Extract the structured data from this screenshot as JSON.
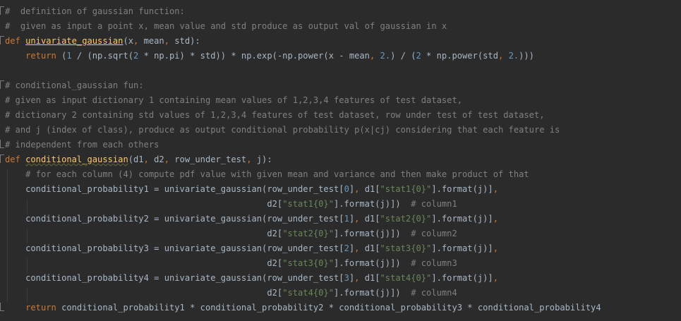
{
  "editor": {
    "background": "#2b2b2b",
    "colors": {
      "comment": "#808080",
      "keyword": "#cc7832",
      "function": "#ffc66d",
      "number": "#6897bb",
      "string": "#6a8759",
      "text": "#a9b7c6"
    },
    "lines": [
      {
        "tokens": [
          {
            "c": "cm",
            "t": "#  definition of gaussian function:"
          }
        ]
      },
      {
        "tokens": [
          {
            "c": "cm",
            "t": "#  given as input a point x, mean value and std produce as output val of gaussian in x"
          }
        ]
      },
      {
        "tokens": [
          {
            "c": "kw",
            "t": "def "
          },
          {
            "c": "fn",
            "t": "univariate_gaussian"
          },
          {
            "c": "var",
            "t": "(x"
          },
          {
            "c": "punct",
            "t": ", "
          },
          {
            "c": "var",
            "t": "mean"
          },
          {
            "c": "punct",
            "t": ", "
          },
          {
            "c": "var",
            "t": "std):"
          }
        ]
      },
      {
        "tokens": [
          {
            "c": "var",
            "t": "    "
          },
          {
            "c": "kw",
            "t": "return "
          },
          {
            "c": "var",
            "t": "("
          },
          {
            "c": "num",
            "t": "1"
          },
          {
            "c": "var",
            "t": " / (np.sqrt("
          },
          {
            "c": "num",
            "t": "2"
          },
          {
            "c": "var",
            "t": " * np.pi) * std)) * np.exp(-np.power(x - mean"
          },
          {
            "c": "punct",
            "t": ", "
          },
          {
            "c": "num",
            "t": "2."
          },
          {
            "c": "var",
            "t": ") / ("
          },
          {
            "c": "num",
            "t": "2"
          },
          {
            "c": "var",
            "t": " * np.power(std"
          },
          {
            "c": "punct",
            "t": ", "
          },
          {
            "c": "num",
            "t": "2."
          },
          {
            "c": "var",
            "t": ")))"
          }
        ]
      },
      {
        "tokens": []
      },
      {
        "tokens": [
          {
            "c": "cm",
            "t": "# conditional_gaussian fun:"
          }
        ]
      },
      {
        "tokens": [
          {
            "c": "cm",
            "t": "# given as input dictionary 1 containing mean values of 1,2,3,4 features of test dataset,"
          }
        ]
      },
      {
        "tokens": [
          {
            "c": "cm",
            "t": "# dictionary 2 containing std values of 1,2,3,4 features of test dataset, row under test of test dataset,"
          }
        ]
      },
      {
        "tokens": [
          {
            "c": "cm",
            "t": "# and j (index of class), produce as output conditional probability p(x|cj) considering that each feature is"
          }
        ]
      },
      {
        "tokens": [
          {
            "c": "cm",
            "t": "# independent from each others"
          }
        ]
      },
      {
        "tokens": [
          {
            "c": "kw",
            "t": "def "
          },
          {
            "c": "fn2",
            "t": "conditional_gaussian"
          },
          {
            "c": "var",
            "t": "(d1"
          },
          {
            "c": "punct",
            "t": ", "
          },
          {
            "c": "var",
            "t": "d2"
          },
          {
            "c": "punct",
            "t": ", "
          },
          {
            "c": "var",
            "t": "row_under_test"
          },
          {
            "c": "punct",
            "t": ", "
          },
          {
            "c": "var",
            "t": "j):"
          }
        ]
      },
      {
        "tokens": [
          {
            "c": "cm",
            "t": "    # for each column (4) compute pdf value with given mean and variance and then make product of that"
          }
        ]
      },
      {
        "tokens": [
          {
            "c": "var",
            "t": "    conditional_probability1 = univariate_gaussian(row_under_test["
          },
          {
            "c": "num",
            "t": "0"
          },
          {
            "c": "var",
            "t": "]"
          },
          {
            "c": "punct",
            "t": ", "
          },
          {
            "c": "var",
            "t": "d1["
          },
          {
            "c": "str",
            "t": "\"stat1{0}\""
          },
          {
            "c": "var",
            "t": "].format(j)]"
          },
          {
            "c": "punct",
            "t": ","
          }
        ]
      },
      {
        "tokens": [
          {
            "c": "var",
            "t": "                                                   d2["
          },
          {
            "c": "str",
            "t": "\"stat1{0}\""
          },
          {
            "c": "var",
            "t": "].format(j)])  "
          },
          {
            "c": "cm",
            "t": "# column1"
          }
        ]
      },
      {
        "tokens": [
          {
            "c": "var",
            "t": "    conditional_probability2 = univariate_gaussian(row_under_test["
          },
          {
            "c": "num",
            "t": "1"
          },
          {
            "c": "var",
            "t": "]"
          },
          {
            "c": "punct",
            "t": ", "
          },
          {
            "c": "var",
            "t": "d1["
          },
          {
            "c": "str",
            "t": "\"stat2{0}\""
          },
          {
            "c": "var",
            "t": "].format(j)]"
          },
          {
            "c": "punct",
            "t": ","
          }
        ]
      },
      {
        "tokens": [
          {
            "c": "var",
            "t": "                                                   d2["
          },
          {
            "c": "str",
            "t": "\"stat2{0}\""
          },
          {
            "c": "var",
            "t": "].format(j)])  "
          },
          {
            "c": "cm",
            "t": "# column2"
          }
        ]
      },
      {
        "tokens": [
          {
            "c": "var",
            "t": "    conditional_probability3 = univariate_gaussian(row_under_test["
          },
          {
            "c": "num",
            "t": "2"
          },
          {
            "c": "var",
            "t": "]"
          },
          {
            "c": "punct",
            "t": ", "
          },
          {
            "c": "var",
            "t": "d1["
          },
          {
            "c": "str",
            "t": "\"stat3{0}\""
          },
          {
            "c": "var",
            "t": "].format(j)]"
          },
          {
            "c": "punct",
            "t": ","
          }
        ]
      },
      {
        "tokens": [
          {
            "c": "var",
            "t": "                                                   d2["
          },
          {
            "c": "str",
            "t": "\"stat3{0}\""
          },
          {
            "c": "var",
            "t": "].format(j)])  "
          },
          {
            "c": "cm",
            "t": "# column3"
          }
        ]
      },
      {
        "tokens": [
          {
            "c": "var",
            "t": "    conditional_probability4 = univariate_gaussian(row_under_test["
          },
          {
            "c": "num",
            "t": "3"
          },
          {
            "c": "var",
            "t": "]"
          },
          {
            "c": "punct",
            "t": ", "
          },
          {
            "c": "var",
            "t": "d1["
          },
          {
            "c": "str",
            "t": "\"stat4{0}\""
          },
          {
            "c": "var",
            "t": "].format(j)]"
          },
          {
            "c": "punct",
            "t": ","
          }
        ]
      },
      {
        "tokens": [
          {
            "c": "var",
            "t": "                                                   d2["
          },
          {
            "c": "str",
            "t": "\"stat4{0}\""
          },
          {
            "c": "var",
            "t": "].format(j)])  "
          },
          {
            "c": "cm",
            "t": "# column4"
          }
        ]
      },
      {
        "tokens": [
          {
            "c": "var",
            "t": "    "
          },
          {
            "c": "kw",
            "t": "return "
          },
          {
            "c": "var",
            "t": "conditional_probability1 * conditional_probability2 * conditional_probability3 * conditional_probability4"
          }
        ]
      }
    ]
  }
}
